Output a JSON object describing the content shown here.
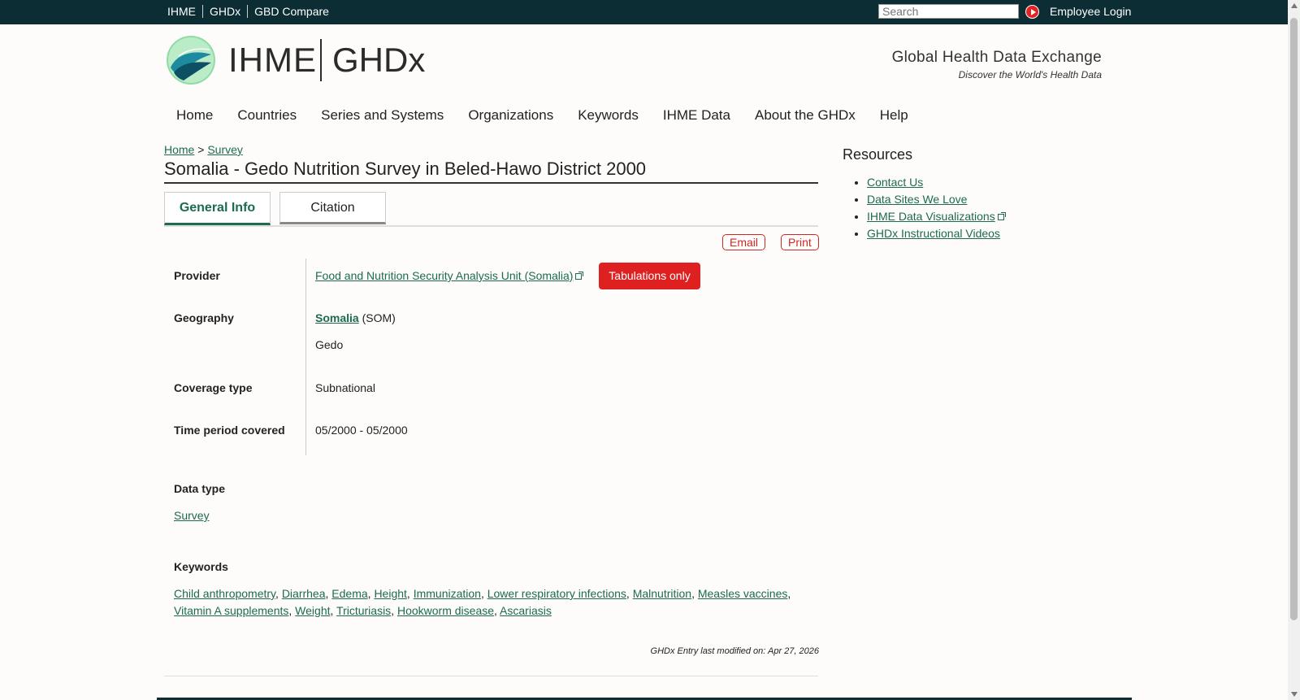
{
  "topbar": {
    "links": [
      "IHME",
      "GHDx",
      "GBD Compare"
    ],
    "search_placeholder": "Search",
    "employee_login": "Employee Login"
  },
  "header": {
    "logo_left": "IHME",
    "logo_right": "GHDx",
    "tagline_title": "Global Health Data Exchange",
    "tagline_sub": "Discover the World's Health Data"
  },
  "nav": [
    "Home",
    "Countries",
    "Series and Systems",
    "Organizations",
    "Keywords",
    "IHME Data",
    "About the GHDx",
    "Help"
  ],
  "breadcrumb": {
    "home": "Home",
    "sep": ">",
    "current": "Survey"
  },
  "page_title": "Somalia - Gedo Nutrition Survey in Beled-Hawo District 2000",
  "tabs": {
    "general": "General Info",
    "citation": "Citation"
  },
  "actions": {
    "email": "Email",
    "print": "Print"
  },
  "info": {
    "provider_label": "Provider",
    "provider_value": "Food and Nutrition Security Analysis Unit (Somalia)",
    "tabulations": "Tabulations only",
    "geography_label": "Geography",
    "geography_country": "Somalia",
    "geography_code": "(SOM)",
    "geography_region": "Gedo",
    "coverage_label": "Coverage type",
    "coverage_value": "Subnational",
    "time_label": "Time period covered",
    "time_value": "05/2000 - 05/2000",
    "datatype_label": "Data type",
    "datatype_value": "Survey",
    "keywords_label": "Keywords"
  },
  "keywords": [
    "Child anthropometry",
    "Diarrhea",
    "Edema",
    "Height",
    "Immunization",
    "Lower respiratory infections",
    "Malnutrition",
    "Measles vaccines",
    "Vitamin A supplements",
    "Weight",
    "Tricturiasis",
    "Hookworm disease",
    "Ascariasis"
  ],
  "modified": "GHDx Entry last modified on: Apr 27, 2026",
  "resources": {
    "title": "Resources",
    "items": [
      "Contact Us",
      "Data Sites We Love",
      "IHME Data Visualizations",
      "GHDx Instructional Videos"
    ]
  },
  "colors": {
    "brand_dark": "#0d2d34",
    "link_green": "#1d6b4d",
    "accent_red": "#df2020"
  }
}
